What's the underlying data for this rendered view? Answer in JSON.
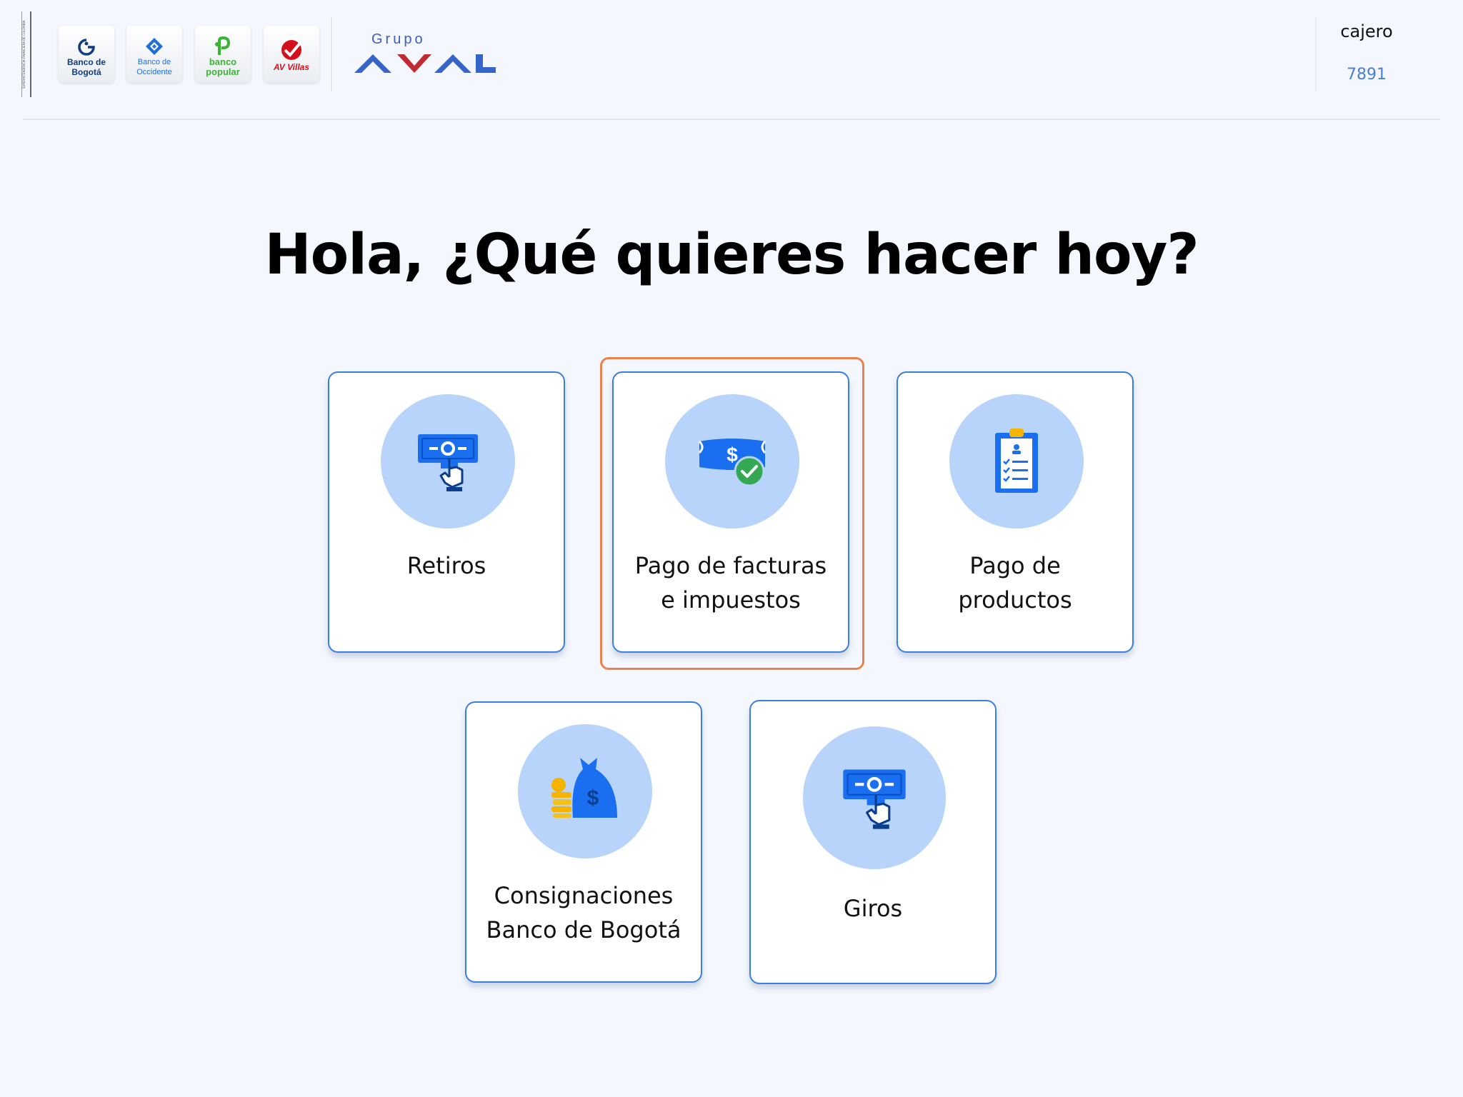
{
  "header": {
    "strip_text": "SUPERINTENDENCIA FINANCIERA DE COLOMBIA",
    "banks": [
      {
        "name": "Banco de Bogotá",
        "line1": "Banco de",
        "line2": "Bogotá",
        "icon": "banco-bogota-logo"
      },
      {
        "name": "Banco de Occidente",
        "line1": "Banco de",
        "line2": "Occidente",
        "icon": "banco-occidente-logo"
      },
      {
        "name": "banco popular",
        "line1": "banco",
        "line2": "popular",
        "icon": "banco-popular-logo"
      },
      {
        "name": "AV Villas",
        "line1": "",
        "line2": "AV Villas",
        "icon": "av-villas-logo"
      }
    ],
    "group_logo": {
      "small": "Grupo",
      "big": "AVAL"
    },
    "terminal": {
      "label": "cajero",
      "id": "7891"
    }
  },
  "main": {
    "title": "Hola, ¿Qué quieres hacer hoy?",
    "options": [
      {
        "label_line1": "Retiros",
        "label_line2": "",
        "icon": "cash-withdrawal-icon",
        "selected": false
      },
      {
        "label_line1": "Pago de facturas",
        "label_line2": "e impuestos",
        "icon": "bill-payment-icon",
        "selected": true
      },
      {
        "label_line1": "Pago de",
        "label_line2": "productos",
        "icon": "clipboard-checklist-icon",
        "selected": false
      },
      {
        "label_line1": "Consignaciones",
        "label_line2": "Banco de Bogotá",
        "icon": "money-bag-coins-icon",
        "selected": false
      },
      {
        "label_line1": "Giros",
        "label_line2": "",
        "icon": "money-transfer-icon",
        "selected": false
      }
    ]
  },
  "colors": {
    "background": "#f4f7fd",
    "card_border": "#3a7ee0",
    "icon_circle": "#b9d4fa",
    "selection": "#ec824b",
    "accent_blue": "#1a6ff0",
    "terminal_id": "#4a7fd6"
  }
}
